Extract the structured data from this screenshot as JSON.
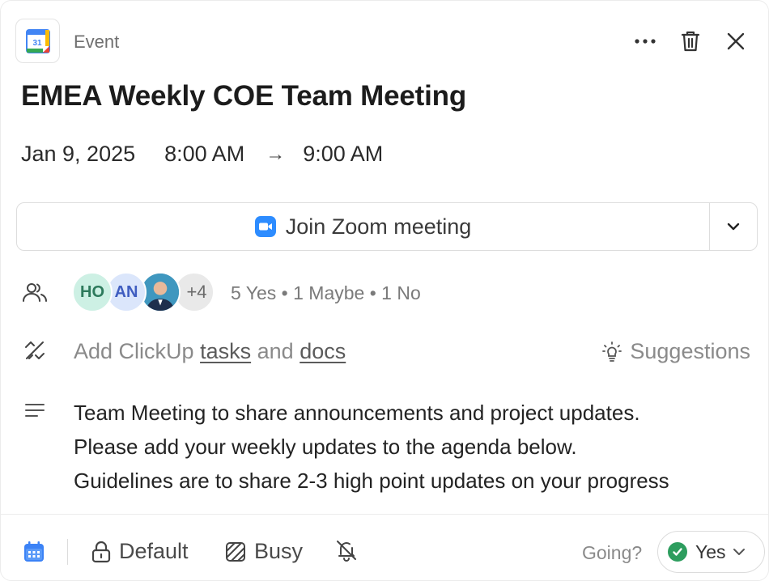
{
  "header": {
    "type_label": "Event",
    "icon_badge": "31",
    "icons": [
      "google-calendar-icon",
      "more-icon",
      "trash-icon",
      "close-icon"
    ]
  },
  "event": {
    "title": "EMEA Weekly COE Team Meeting",
    "date": "Jan 9, 2025",
    "start_time": "8:00 AM",
    "arrow": "→",
    "end_time": "9:00 AM"
  },
  "zoom": {
    "label": "Join Zoom meeting",
    "accent": "#2d8cff"
  },
  "attendees": {
    "avatars": [
      {
        "initials": "HO"
      },
      {
        "initials": "AN"
      },
      {
        "initials": ""
      },
      {
        "initials": "+4"
      }
    ],
    "rsvp_summary": "5 Yes • 1 Maybe • 1 No"
  },
  "tasks": {
    "prefix": "Add ClickUp",
    "tasks_link": "tasks",
    "and": "and",
    "docs_link": "docs",
    "suggestions_label": "Suggestions"
  },
  "description": {
    "lines": [
      "Team Meeting to share announcements and project updates.",
      "Please add your weekly updates to the agenda below.",
      "Guidelines are to share 2-3 high point updates on your progress"
    ]
  },
  "footer": {
    "visibility_label": "Default",
    "busy_label": "Busy",
    "going_label": "Going?",
    "rsvp_value": "Yes",
    "calendar_accent": "#3b82f6",
    "yes_color": "#2d9d5e"
  }
}
